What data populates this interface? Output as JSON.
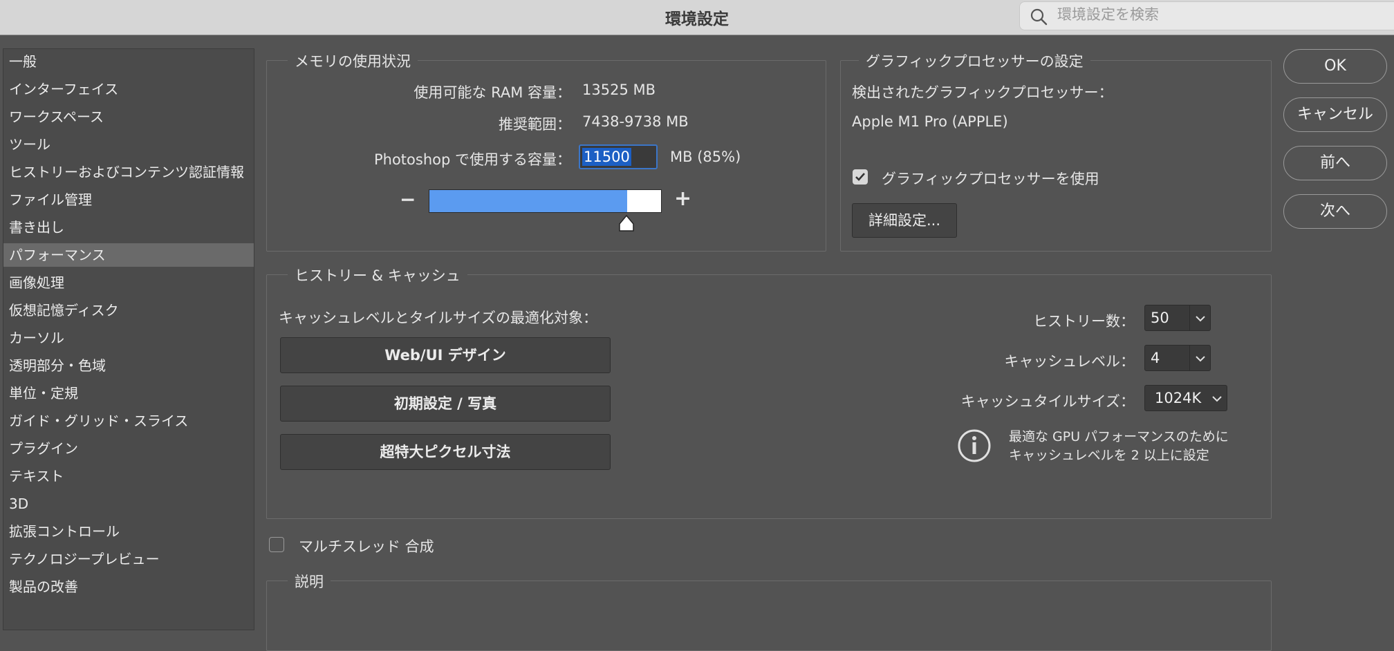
{
  "window": {
    "title": "環境設定",
    "search_placeholder": "環境設定を検索"
  },
  "sidebar": {
    "items": [
      {
        "label": "一般"
      },
      {
        "label": "インターフェイス"
      },
      {
        "label": "ワークスペース"
      },
      {
        "label": "ツール"
      },
      {
        "label": "ヒストリーおよびコンテンツ認証情報"
      },
      {
        "label": "ファイル管理"
      },
      {
        "label": "書き出し"
      },
      {
        "label": "パフォーマンス"
      },
      {
        "label": "画像処理"
      },
      {
        "label": "仮想記憶ディスク"
      },
      {
        "label": "カーソル"
      },
      {
        "label": "透明部分・色域"
      },
      {
        "label": "単位・定規"
      },
      {
        "label": "ガイド・グリッド・スライス"
      },
      {
        "label": "プラグイン"
      },
      {
        "label": "テキスト"
      },
      {
        "label": "3D"
      },
      {
        "label": "拡張コントロール"
      },
      {
        "label": "テクノロジープレビュー"
      },
      {
        "label": "製品の改善"
      }
    ],
    "selected": "パフォーマンス"
  },
  "memory": {
    "title": "メモリの使用状況",
    "ram_label": "使用可能な RAM 容量：",
    "ram_value": "13525 MB",
    "range_label": "推奨範囲：",
    "range_value": "7438-9738 MB",
    "use_label": "Photoshop で使用する容量：",
    "use_value": "11500",
    "use_unit": "MB (85%)",
    "slider_fraction": 0.85,
    "minus": "−",
    "plus": "+"
  },
  "gpu": {
    "title": "グラフィックプロセッサーの設定",
    "detected_label": "検出されたグラフィックプロセッサー：",
    "gpu_name": "Apple M1 Pro (APPLE)",
    "use_label": "グラフィックプロセッサーを使用",
    "use_checked": true,
    "advanced_button": "詳細設定..."
  },
  "history_cache": {
    "title": "ヒストリー & キャッシュ",
    "optimize_label": "キャッシュレベルとタイルサイズの最適化対象：",
    "buttons": [
      "Web/UI デザイン",
      "初期設定 / 写真",
      "超特大ピクセル寸法"
    ],
    "history_label": "ヒストリー数：",
    "history_value": "50",
    "cache_level_label": "キャッシュレベル：",
    "cache_level_value": "4",
    "tile_size_label": "キャッシュタイルサイズ：",
    "tile_size_value": "1024K",
    "info_line1": "最適な GPU パフォーマンスのために",
    "info_line2": "キャッシュレベルを 2 以上に設定"
  },
  "multithread": {
    "label": "マルチスレッド 合成",
    "checked": false
  },
  "description": {
    "title": "説明"
  },
  "actions": {
    "ok": "OK",
    "cancel": "キャンセル",
    "prev": "前へ",
    "next": "次へ"
  },
  "colors": {
    "accent": "#5b9bf0",
    "selection": "#1c5fc4"
  }
}
